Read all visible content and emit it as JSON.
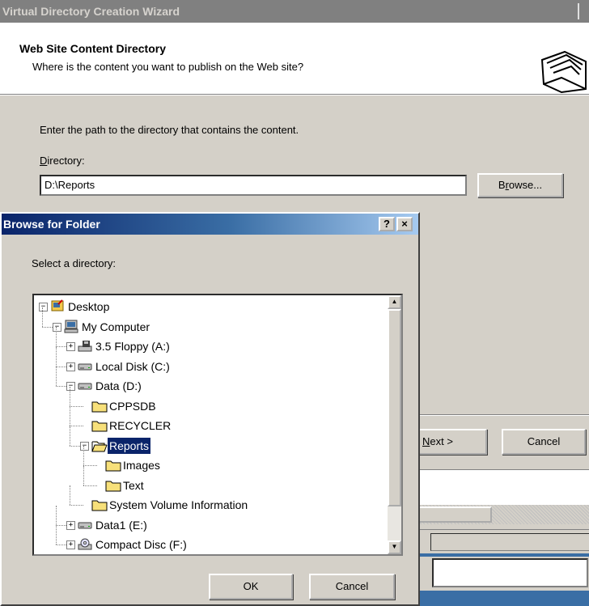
{
  "wizard": {
    "title": "Virtual Directory Creation Wizard",
    "header_title": "Web Site Content Directory",
    "header_subtitle": "Where is the content you want to publish on the Web site?",
    "instruction": "Enter the path to the directory that contains the content.",
    "directory_label_hotkey": "D",
    "directory_label_rest": "irectory:",
    "directory_value": "D:\\Reports",
    "browse_hotkey": "r",
    "browse_pre": "B",
    "browse_post": "owse...",
    "next_hotkey": "N",
    "next_rest": "ext >",
    "cancel_label": "Cancel"
  },
  "dialog": {
    "title": "Browse for Folder",
    "help_label": "?",
    "close_label": "×",
    "prompt": "Select a directory:",
    "ok_label": "OK",
    "cancel_label": "Cancel",
    "tree": [
      {
        "label": "Desktop",
        "icon": "desktop-icon",
        "expander": "−"
      },
      {
        "label": "My Computer",
        "icon": "my-computer-icon",
        "expander": "−"
      },
      {
        "label": "3.5 Floppy (A:)",
        "icon": "floppy-drive-icon",
        "expander": "+"
      },
      {
        "label": "Local Disk (C:)",
        "icon": "hard-drive-icon",
        "expander": "+"
      },
      {
        "label": "Data (D:)",
        "icon": "hard-drive-icon",
        "expander": "−"
      },
      {
        "label": "CPPSDB",
        "icon": "folder-icon",
        "expander": ""
      },
      {
        "label": "RECYCLER",
        "icon": "folder-icon",
        "expander": ""
      },
      {
        "label": "Reports",
        "icon": "open-folder-icon",
        "expander": "−",
        "selected": true
      },
      {
        "label": "Images",
        "icon": "folder-icon",
        "expander": ""
      },
      {
        "label": "Text",
        "icon": "folder-icon",
        "expander": ""
      },
      {
        "label": "System Volume Information",
        "icon": "folder-icon",
        "expander": ""
      },
      {
        "label": "Data1 (E:)",
        "icon": "hard-drive-icon",
        "expander": "+"
      },
      {
        "label": "Compact Disc (F:)",
        "icon": "cd-drive-icon",
        "expander": "+"
      }
    ]
  },
  "colors": {
    "selection": "#0a246a",
    "title_active": "#0a246a",
    "title_inactive": "#808080",
    "face": "#d4d0c8"
  }
}
